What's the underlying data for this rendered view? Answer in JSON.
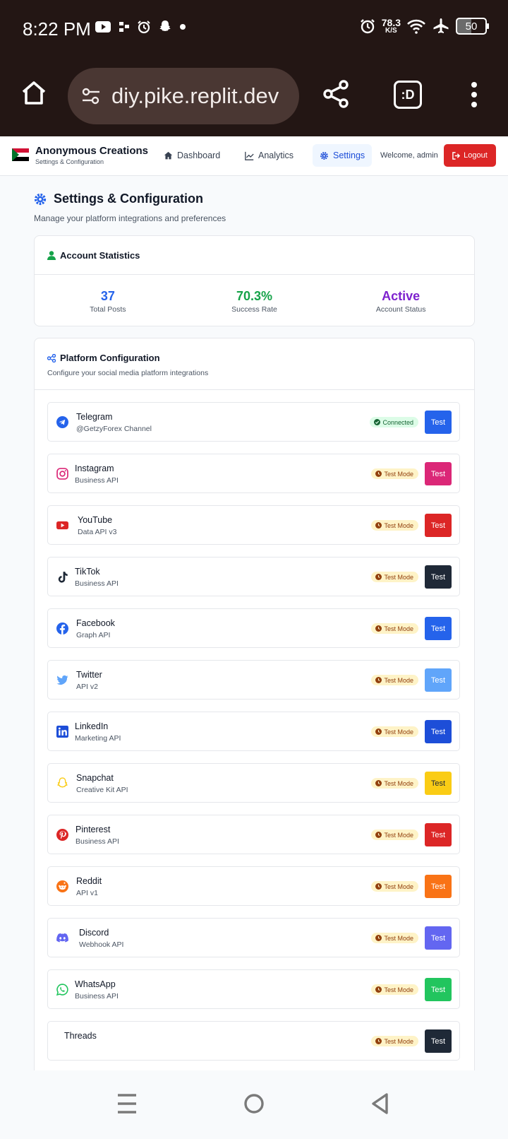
{
  "status_bar": {
    "time": "8:22 PM",
    "speed_value": "78.3",
    "speed_unit": "K/S",
    "battery": "50"
  },
  "browser": {
    "url": "diy.pike.replit.dev",
    "tab_label": ":D"
  },
  "app": {
    "brand": "Anonymous Creations",
    "brand_sub": "Settings & Configuration",
    "nav": {
      "dashboard": "Dashboard",
      "analytics": "Analytics",
      "settings": "Settings"
    },
    "welcome": "Welcome, admin",
    "logout": "Logout"
  },
  "page": {
    "title": "Settings & Configuration",
    "subtitle": "Manage your platform integrations and preferences"
  },
  "account_stats": {
    "title": "Account Statistics",
    "items": [
      {
        "value": "37",
        "label": "Total Posts",
        "color": "#2563eb"
      },
      {
        "value": "70.3%",
        "label": "Success Rate",
        "color": "#16a34a"
      },
      {
        "value": "Active",
        "label": "Account Status",
        "color": "#7e22ce"
      }
    ]
  },
  "platform_config": {
    "title": "Platform Configuration",
    "subtitle": "Configure your social media platform integrations",
    "test_label": "Test",
    "platforms": [
      {
        "name": "Telegram",
        "desc": "@GetzyForex Channel",
        "status": "Connected",
        "icon": "telegram-icon",
        "color": "#2563eb"
      },
      {
        "name": "Instagram",
        "desc": "Business API",
        "status": "Test Mode",
        "icon": "instagram-icon",
        "color": "#db2777"
      },
      {
        "name": "YouTube",
        "desc": "Data API v3",
        "status": "Test Mode",
        "icon": "youtube-icon",
        "color": "#dc2626"
      },
      {
        "name": "TikTok",
        "desc": "Business API",
        "status": "Test Mode",
        "icon": "tiktok-icon",
        "color": "#1f2937"
      },
      {
        "name": "Facebook",
        "desc": "Graph API",
        "status": "Test Mode",
        "icon": "facebook-icon",
        "color": "#2563eb"
      },
      {
        "name": "Twitter",
        "desc": "API v2",
        "status": "Test Mode",
        "icon": "twitter-icon",
        "color": "#60a5fa"
      },
      {
        "name": "LinkedIn",
        "desc": "Marketing API",
        "status": "Test Mode",
        "icon": "linkedin-icon",
        "color": "#1d4ed8"
      },
      {
        "name": "Snapchat",
        "desc": "Creative Kit API",
        "status": "Test Mode",
        "icon": "snapchat-icon",
        "color": "#facc15"
      },
      {
        "name": "Pinterest",
        "desc": "Business API",
        "status": "Test Mode",
        "icon": "pinterest-icon",
        "color": "#dc2626"
      },
      {
        "name": "Reddit",
        "desc": "API v1",
        "status": "Test Mode",
        "icon": "reddit-icon",
        "color": "#f97316"
      },
      {
        "name": "Discord",
        "desc": "Webhook API",
        "status": "Test Mode",
        "icon": "discord-icon",
        "color": "#6366f1"
      },
      {
        "name": "WhatsApp",
        "desc": "Business API",
        "status": "Test Mode",
        "icon": "whatsapp-icon",
        "color": "#22c55e"
      },
      {
        "name": "Threads",
        "desc": "",
        "status": "Test Mode",
        "icon": "threads-icon",
        "color": "#1f2937"
      }
    ]
  }
}
